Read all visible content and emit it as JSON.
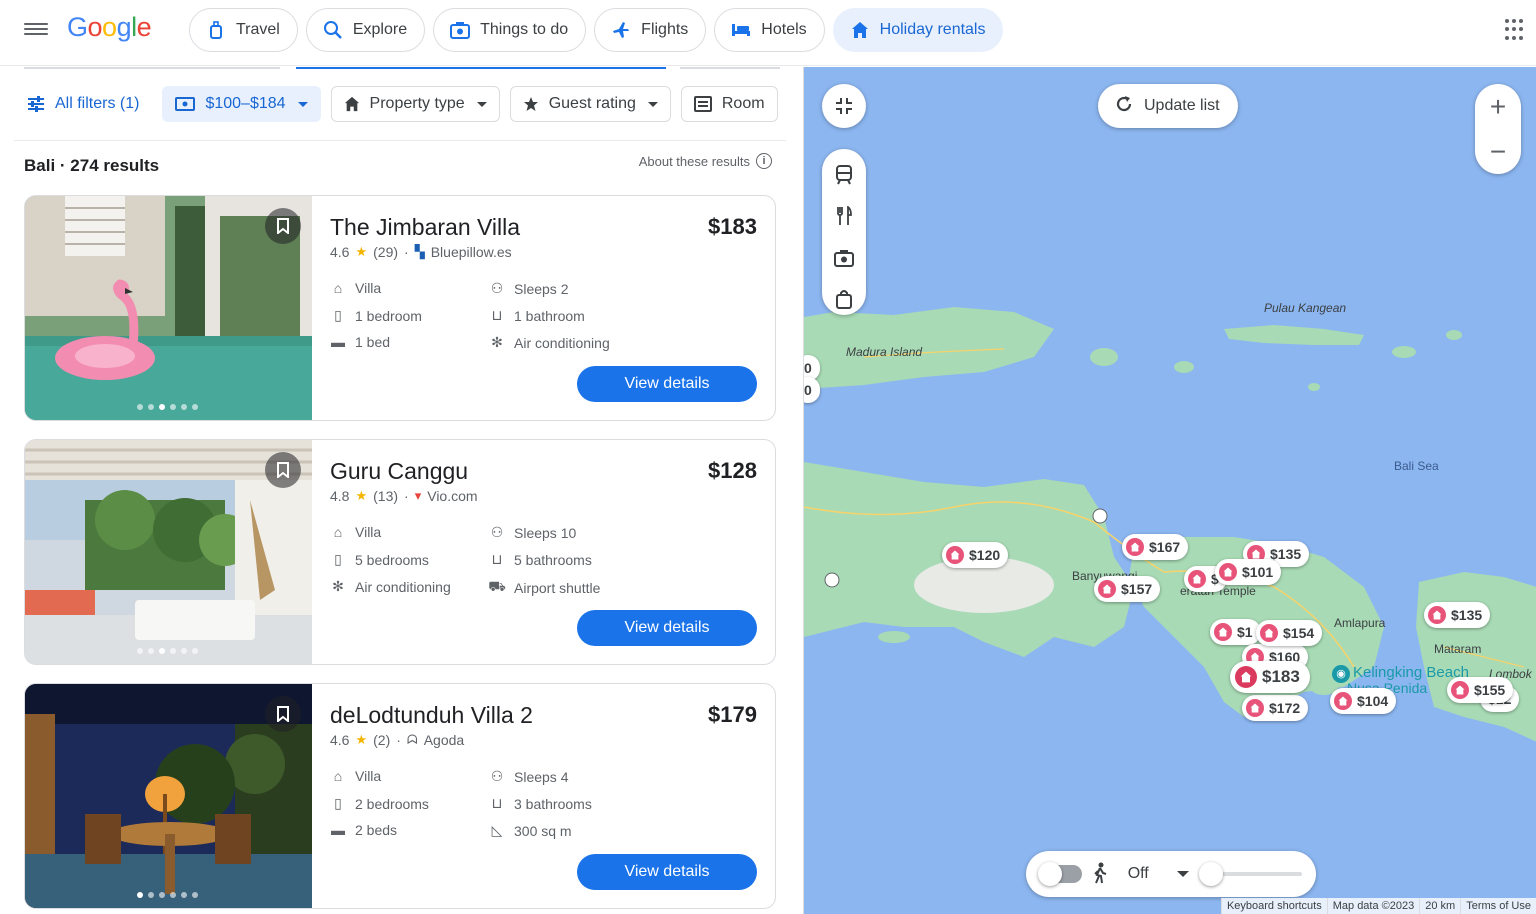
{
  "header": {
    "logo": "Google",
    "tabs": [
      {
        "label": "Travel",
        "icon": "travel-bag-icon"
      },
      {
        "label": "Explore",
        "icon": "explore-icon"
      },
      {
        "label": "Things to do",
        "icon": "camera-icon"
      },
      {
        "label": "Flights",
        "icon": "plane-icon"
      },
      {
        "label": "Hotels",
        "icon": "bed-icon"
      },
      {
        "label": "Holiday rentals",
        "icon": "house-icon",
        "active": true
      }
    ]
  },
  "filters": {
    "all_filters": "All filters (1)",
    "price": "$100–$184",
    "property_type": "Property type",
    "guest_rating": "Guest rating",
    "room": "Room"
  },
  "results": {
    "title": "Bali · 274 results",
    "about": "About these results"
  },
  "listings": [
    {
      "name": "The Jimbaran Villa",
      "price": "$183",
      "rating": "4.6",
      "reviews": "(29)",
      "source": "Bluepillow.es",
      "features_left": [
        "Villa",
        "1 bedroom",
        "1 bed"
      ],
      "features_right": [
        "Sleeps 2",
        "1 bathroom",
        "Air conditioning"
      ],
      "button": "View details"
    },
    {
      "name": "Guru Canggu",
      "price": "$128",
      "rating": "4.8",
      "reviews": "(13)",
      "source": "Vio.com",
      "features_left": [
        "Villa",
        "5 bedrooms",
        "Air conditioning"
      ],
      "features_right": [
        "Sleeps 10",
        "5 bathrooms",
        "Airport shuttle"
      ],
      "button": "View details"
    },
    {
      "name": "deLodtunduh Villa 2",
      "price": "$179",
      "rating": "4.6",
      "reviews": "(2)",
      "source": "Agoda",
      "features_left": [
        "Villa",
        "2 bedrooms",
        "2 beds"
      ],
      "features_right": [
        "Sleeps 4",
        "3 bathrooms",
        "300 sq m"
      ],
      "button": "View details"
    }
  ],
  "map": {
    "update_list": "Update list",
    "zoom_in": "+",
    "zoom_out": "−",
    "labels": {
      "madura": "Madura Island",
      "kangean": "Pulau Kangean",
      "bali_sea": "Bali Sea",
      "banyuwangi": "Banyuwangi",
      "temple": "eratan Temple",
      "amlapura": "Amlapura",
      "mataram": "Mataram",
      "kelingking": "Kelingking Beach",
      "nusa_penida": "Nusa Penida",
      "lombok": "Lombok"
    },
    "pins": [
      "$120",
      "$167",
      "$157",
      "$135",
      "$101",
      "$1",
      "$154",
      "$160",
      "$183",
      "$172",
      "$104",
      "$135",
      "$155",
      "$12",
      "0",
      "0",
      "$"
    ],
    "time_filter": "Off",
    "attribution": [
      "Keyboard shortcuts",
      "Map data ©2023",
      "20 km",
      "Terms of Use"
    ]
  },
  "colors": {
    "accent": "#1a73e8",
    "active_tab_bg": "#e8f0fe",
    "water": "#8cb6f0",
    "land": "#a8dab5",
    "pin": "#e8537a"
  }
}
